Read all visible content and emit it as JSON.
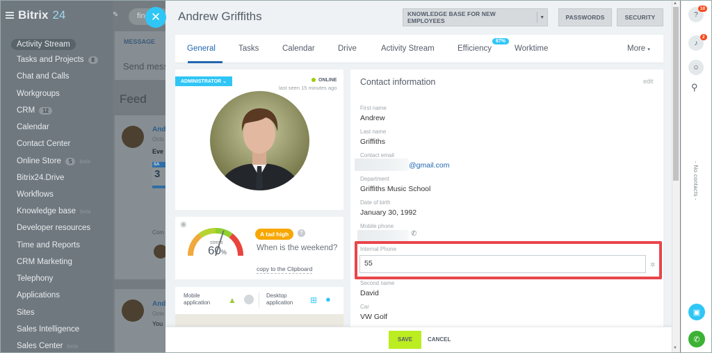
{
  "app": {
    "logo_main": "Bitrix",
    "logo_num": "24"
  },
  "sidebar": {
    "items": [
      {
        "label": "Activity Stream",
        "count": "",
        "beta": ""
      },
      {
        "label": "Tasks and Projects",
        "count": "8",
        "beta": ""
      },
      {
        "label": "Chat and Calls",
        "count": "",
        "beta": ""
      },
      {
        "label": "Workgroups",
        "count": "",
        "beta": ""
      },
      {
        "label": "CRM",
        "count": "12",
        "beta": ""
      },
      {
        "label": "Calendar",
        "count": "",
        "beta": ""
      },
      {
        "label": "Contact Center",
        "count": "",
        "beta": ""
      },
      {
        "label": "Online Store",
        "count": "5",
        "beta": "beta"
      },
      {
        "label": "Bitrix24.Drive",
        "count": "",
        "beta": ""
      },
      {
        "label": "Workflows",
        "count": "",
        "beta": ""
      },
      {
        "label": "Knowledge base",
        "count": "",
        "beta": "beta"
      },
      {
        "label": "Developer resources",
        "count": "",
        "beta": ""
      },
      {
        "label": "Time and Reports",
        "count": "",
        "beta": ""
      },
      {
        "label": "CRM Marketing",
        "count": "",
        "beta": ""
      },
      {
        "label": "Telephony",
        "count": "",
        "beta": ""
      },
      {
        "label": "Applications",
        "count": "",
        "beta": ""
      },
      {
        "label": "Sites",
        "count": "",
        "beta": ""
      },
      {
        "label": "Sales Intelligence",
        "count": "",
        "beta": ""
      },
      {
        "label": "Sales Center",
        "count": "",
        "beta": "beta"
      }
    ]
  },
  "background": {
    "search_text": "find",
    "message_tab": "MESSAGE",
    "send_placeholder": "Send mess",
    "feed_title": "Feed",
    "post1_author": "And",
    "post1_date": "Octo",
    "post1_text": "Eve",
    "post1_calendar_month": "SA",
    "post1_calendar_day": "3",
    "post1_comment": "Com",
    "post2_author": "And",
    "post2_date": "Octo",
    "post2_text": "You"
  },
  "panel": {
    "title": "Andrew Griffiths",
    "header_buttons": {
      "knowledge_base": "KNOWLEDGE BASE FOR NEW EMPLOYEES",
      "passwords": "PASSWORDS",
      "security": "SECURITY"
    },
    "tabs": [
      "General",
      "Tasks",
      "Calendar",
      "Drive",
      "Activity Stream",
      "Efficiency",
      "Worktime",
      "More"
    ],
    "efficiency_badge": "67%",
    "profile": {
      "role_badge": "ADMINISTRATOR",
      "status": "ONLINE",
      "last_seen": "last seen 15 minutes ago"
    },
    "stress": {
      "label": "stress",
      "value": "60",
      "unit": "%",
      "level_badge": "A tad high",
      "question": "When is the weekend?",
      "copy_link": "copy to the Clipboard",
      "gauge_fraction": 0.6
    },
    "apps": {
      "mobile": "Mobile application",
      "desktop": "Desktop application"
    },
    "contact": {
      "title": "Contact information",
      "edit": "edit",
      "fields": [
        {
          "label": "First name",
          "value": "Andrew"
        },
        {
          "label": "Last name",
          "value": "Griffiths"
        },
        {
          "label": "Contact email",
          "value": "@gmail.com"
        },
        {
          "label": "Department",
          "value": "Griffiths Music School"
        },
        {
          "label": "Date of birth",
          "value": "January 30, 1992"
        },
        {
          "label": "Mobile phone",
          "value": ""
        }
      ],
      "internal_phone_label": "Internal Phone",
      "internal_phone_value": "55",
      "fields_after": [
        {
          "label": "Second name",
          "value": "David"
        },
        {
          "label": "Car",
          "value": "VW Golf"
        }
      ]
    },
    "footer": {
      "save": "SAVE",
      "cancel": "CANCEL"
    }
  },
  "right_bar": {
    "help_badge": "10",
    "notif_badge": "2",
    "no_contacts": "- No contacts -"
  },
  "colors": {
    "accent": "#2fc6f6",
    "link": "#2067b0",
    "save": "#bbed21",
    "highlight": "#e8454b",
    "badge_orange": "#f7a700",
    "online": "#9dcf00"
  }
}
